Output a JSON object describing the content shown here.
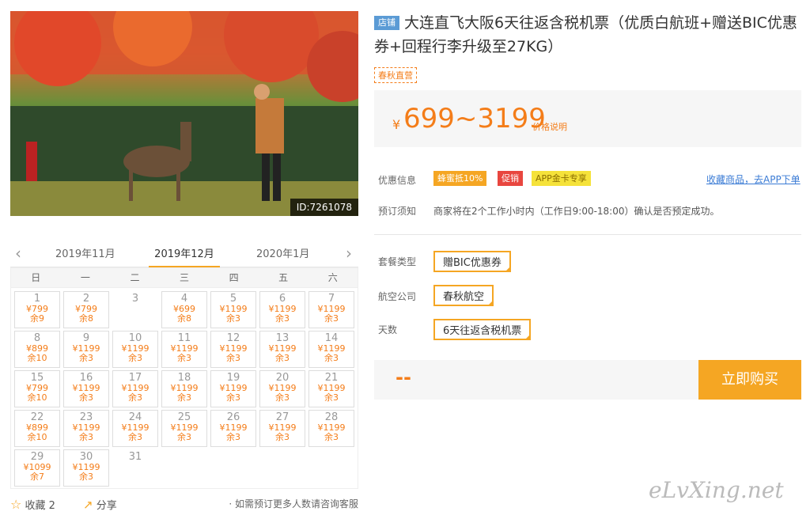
{
  "product": {
    "image_id": "ID:7261078",
    "tag": "店铺",
    "title": "大连直飞大阪6天往返含税机票（优质白航班+赠送BIC优惠券+回程行李升级至27KG）",
    "vendor": "春秋直营",
    "currency": "¥",
    "price": "699~3199",
    "price_note": "价格说明"
  },
  "promo": {
    "label": "优惠信息",
    "badges": [
      "蜂蜜抵10%",
      "促销",
      "APP金卡专享"
    ],
    "badge_colors": [
      "#f5a623",
      "#e8463f",
      "#f5e23a"
    ],
    "link": "收藏商品，去APP下单"
  },
  "booking": {
    "label": "预订须知",
    "text": "商家将在2个工作小时内（工作日9:00-18:00）确认是否预定成功。"
  },
  "options": [
    {
      "label": "套餐类型",
      "value": "赠BIC优惠券"
    },
    {
      "label": "航空公司",
      "value": "春秋航空"
    },
    {
      "label": "天数",
      "value": "6天往返含税机票"
    }
  ],
  "buy": {
    "placeholder": "--",
    "button": "立即购买"
  },
  "calendar": {
    "prev_icon": "‹",
    "next_icon": "›",
    "months": [
      "2019年11月",
      "2019年12月",
      "2020年1月"
    ],
    "active_month": 1,
    "weekdays": [
      "日",
      "一",
      "二",
      "三",
      "四",
      "五",
      "六"
    ],
    "days": [
      {
        "d": "1",
        "p": "¥799",
        "s": "余9"
      },
      {
        "d": "2",
        "p": "¥799",
        "s": "余8"
      },
      {
        "d": "3",
        "p": "",
        "s": ""
      },
      {
        "d": "4",
        "p": "¥699",
        "s": "余8"
      },
      {
        "d": "5",
        "p": "¥1199",
        "s": "余3"
      },
      {
        "d": "6",
        "p": "¥1199",
        "s": "余3"
      },
      {
        "d": "7",
        "p": "¥1199",
        "s": "余3"
      },
      {
        "d": "8",
        "p": "¥899",
        "s": "余10"
      },
      {
        "d": "9",
        "p": "¥1199",
        "s": "余3"
      },
      {
        "d": "10",
        "p": "¥1199",
        "s": "余3"
      },
      {
        "d": "11",
        "p": "¥1199",
        "s": "余3"
      },
      {
        "d": "12",
        "p": "¥1199",
        "s": "余3"
      },
      {
        "d": "13",
        "p": "¥1199",
        "s": "余3"
      },
      {
        "d": "14",
        "p": "¥1199",
        "s": "余3"
      },
      {
        "d": "15",
        "p": "¥799",
        "s": "余10"
      },
      {
        "d": "16",
        "p": "¥1199",
        "s": "余3"
      },
      {
        "d": "17",
        "p": "¥1199",
        "s": "余3"
      },
      {
        "d": "18",
        "p": "¥1199",
        "s": "余3"
      },
      {
        "d": "19",
        "p": "¥1199",
        "s": "余3"
      },
      {
        "d": "20",
        "p": "¥1199",
        "s": "余3"
      },
      {
        "d": "21",
        "p": "¥1199",
        "s": "余3"
      },
      {
        "d": "22",
        "p": "¥899",
        "s": "余10"
      },
      {
        "d": "23",
        "p": "¥1199",
        "s": "余3"
      },
      {
        "d": "24",
        "p": "¥1199",
        "s": "余3"
      },
      {
        "d": "25",
        "p": "¥1199",
        "s": "余3"
      },
      {
        "d": "26",
        "p": "¥1199",
        "s": "余3"
      },
      {
        "d": "27",
        "p": "¥1199",
        "s": "余3"
      },
      {
        "d": "28",
        "p": "¥1199",
        "s": "余3"
      },
      {
        "d": "29",
        "p": "¥1099",
        "s": "余7"
      },
      {
        "d": "30",
        "p": "¥1199",
        "s": "余3"
      },
      {
        "d": "31",
        "p": "",
        "s": ""
      }
    ]
  },
  "footer": {
    "fav_icon": "☆",
    "fav": "收藏 2",
    "share_icon": "↗",
    "share": "分享",
    "tip": "· 如需预订更多人数请咨询客服"
  },
  "watermark": "eLvXing.net"
}
